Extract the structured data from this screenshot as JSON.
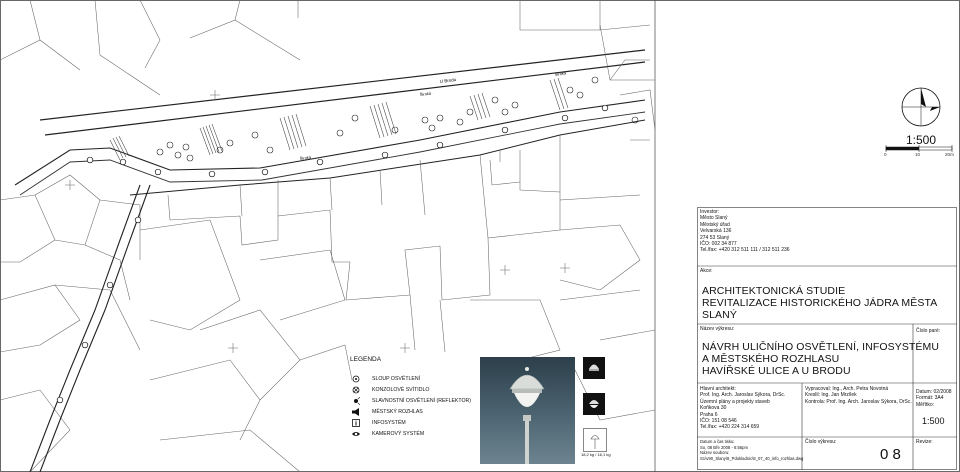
{
  "drawing": {
    "street_labels": [
      "U Brodu",
      "Široká",
      "Široká",
      "Široká"
    ],
    "scale": "1:500",
    "scale_ticks": [
      "0",
      "10",
      "20m"
    ]
  },
  "legend": {
    "title": "LEGENDA",
    "items": [
      {
        "label": "SLOUP OSVĚTLENÍ",
        "icon": "pole-light-icon"
      },
      {
        "label": "KONZOLOVÉ SVÍTIDLO",
        "icon": "bracket-light-icon"
      },
      {
        "label": "SLAVNOSTNÍ OSVĚTLENÍ (REFLEKTOR)",
        "icon": "floodlight-icon"
      },
      {
        "label": "MĚSTSKÝ ROZHLAS",
        "icon": "loudspeaker-icon"
      },
      {
        "label": "INFOSYSTÉM",
        "icon": "info-icon"
      },
      {
        "label": "KAMEROVÝ SYSTÉM",
        "icon": "camera-eye-icon"
      }
    ]
  },
  "lamp_caption": "18,2 kg / 16,1 kg",
  "investor": {
    "label": "Investor:",
    "lines": [
      "Město Slaný",
      "Městský úřad",
      "Velvarská 136",
      "274 53  Slaný",
      "IČO: 002 34 877",
      "Tel./fax: +420 312 511 111 / 312 511 236"
    ]
  },
  "action": {
    "label": "Akce:",
    "lines": [
      "ARCHITEKTONICKÁ STUDIE",
      "REVITALIZACE HISTORICKÉHO JÁDRA MĚSTA SLANÝ"
    ]
  },
  "drawing_name": {
    "label": "Název výkresu:",
    "lines": [
      "NÁVRH ULIČNÍHO OSVĚTLENÍ,  INFOSYSTÉMU",
      "A MĚSTSKÉHO ROZHLASU",
      "HAVÍŘSKÉ ULICE A U BRODU"
    ],
    "part_label": "Číslo paré:"
  },
  "architect": {
    "label": "Hlavní architekt:",
    "lines": [
      "Prof. Ing. Arch. Jaroslav Sýkora, DrSc.",
      "Územní plány a projekty staveb",
      "Koňkova 30",
      "Praha 6",
      "IČO: 151 08 546",
      "Tel./fax: +420 224 314 659"
    ]
  },
  "people": {
    "lines": [
      "Vypracoval: Ing., Arch. Petra Novotná",
      "Kreslil:        Ing. Jan Mrzílek",
      "Kontrola:     Prof. Ing. Arch. Jaroslav Sýkora, DrSc."
    ]
  },
  "meta": {
    "lines": [
      "Datum:  02/2008",
      "Formát:  3A4",
      "Měřítko:"
    ],
    "scale": "1:500"
  },
  "print": {
    "lines": [
      "Datum a čas tisku:",
      "So, 08 Bře 2008  -  6:56pm",
      "Název souboru:",
      "S1\\v90_Slany\\8_Pdokladnic\\8_07_40_info_rozhlas.dwg"
    ]
  },
  "drawing_number": {
    "label": "Číslo výkresu:",
    "value": "0  8"
  },
  "revision": {
    "label": "Revize:"
  }
}
